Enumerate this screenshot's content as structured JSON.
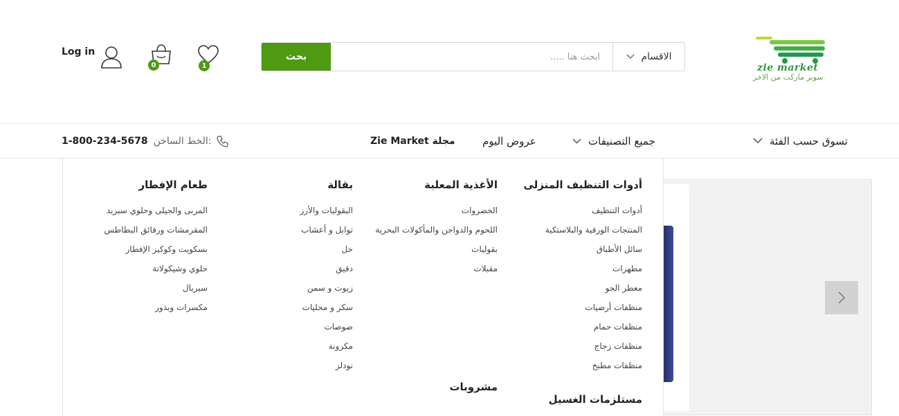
{
  "header": {
    "logo": {
      "brand": "zie market",
      "tagline": "سوبر ماركت من الاخر"
    },
    "search": {
      "category_label": "الاقسام",
      "placeholder": "ابحث هنا .....",
      "button_label": "بحث"
    },
    "wishlist": {
      "count": "1"
    },
    "cart": {
      "count": "0"
    },
    "login_label": "Log in"
  },
  "nav": {
    "shop_by_category": "تسوق حسب الفئة",
    "all_categories": "جميع التصنيفات",
    "todays_deals": "عروض اليوم",
    "magazine": "مجلة Zie Market",
    "hotline_label": "الخط الساخن:",
    "hotline_number": "1-800-234-5678"
  },
  "mega_menu": {
    "columns": [
      {
        "title": "أدوات التنظيف المنزلى",
        "items": [
          "أدوات التنظيف",
          "المنتجات الورقية والبلاستكية",
          "سائل الأطباق",
          "مطهرات",
          "معطر الجو",
          "منظفات أرضيات",
          "منظفات حمام",
          "منظفات زجاج",
          "منظفات مطبخ"
        ],
        "second_title": "مستلزمات الغسيل"
      },
      {
        "title": "الأغذية المعلبة",
        "items": [
          "الخضروات",
          "اللحوم والدواجن والمأكولات البحرية",
          "بقوليات",
          "مقبلات"
        ],
        "second_title": "مشروبات"
      },
      {
        "title": "بقالة",
        "items": [
          "البقوليات والأرز",
          "توابل و أعشاب",
          "خل",
          "دقيق",
          "زيوت و سمن",
          "سكر و محليات",
          "صوصات",
          "مكرونة",
          "نودلز"
        ]
      },
      {
        "title": "طعام الإفطار",
        "items": [
          "المربى والجيلى وحلوي سبريد",
          "المقرمشات ورقائق البطاطس",
          "بسكويت وكوكيز الإفطار",
          "حلوي وشيكولاتة",
          "سيريال",
          "مكسرات وبذور"
        ]
      }
    ]
  },
  "colors": {
    "accent": "#4e9a12",
    "logo_green": "#2e9a3a",
    "border": "#e6e6e6"
  },
  "icons": [
    "chevron-down-icon",
    "heart-icon",
    "cart-icon",
    "user-icon",
    "phone-icon",
    "chevron-right-icon"
  ]
}
